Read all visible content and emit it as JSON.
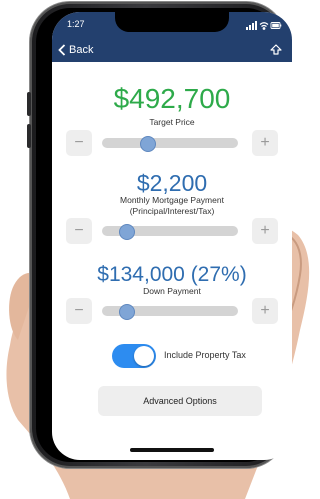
{
  "status_bar": {
    "time": "1:27"
  },
  "nav": {
    "back_label": "Back"
  },
  "colors": {
    "header": "#23406e",
    "price_green": "#2eaa4a",
    "value_blue": "#2f6db0",
    "toggle_on": "#2d8cf0"
  },
  "target_price": {
    "value": "$492,700",
    "label": "Target Price",
    "slider_position": 0.33
  },
  "monthly_payment": {
    "value": "$2,200",
    "label_line1": "Monthly Mortgage Payment",
    "label_line2": "(Principal/Interest/Tax)",
    "slider_position": 0.18
  },
  "down_payment": {
    "value": "$134,000 (27%)",
    "label": "Down Payment",
    "slider_position": 0.18
  },
  "stepper": {
    "minus": "−",
    "plus": "+"
  },
  "property_tax_toggle": {
    "label": "Include Property Tax",
    "on": true
  },
  "advanced": {
    "label": "Advanced Options"
  }
}
